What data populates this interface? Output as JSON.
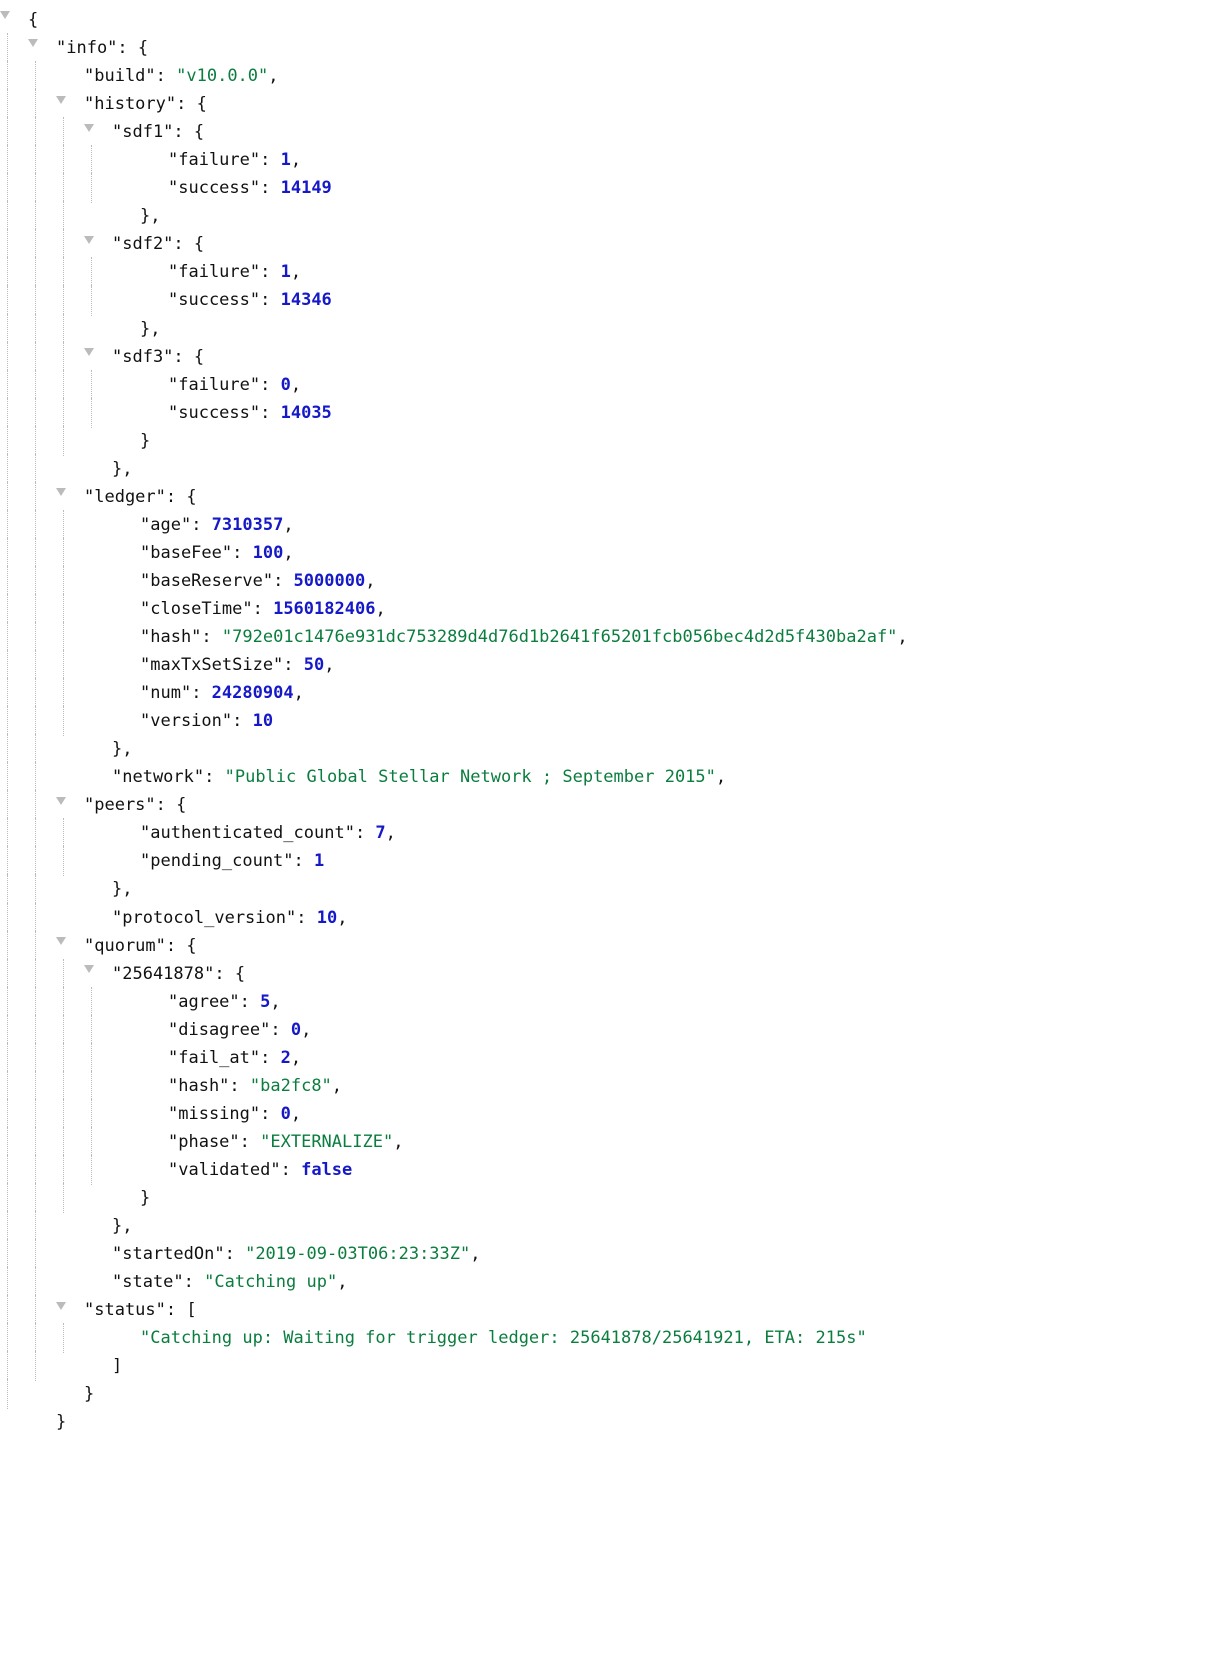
{
  "tree": [
    {
      "depth": 0,
      "guides": "",
      "toggle": true,
      "tokens": [
        {
          "t": "pun",
          "v": "{"
        }
      ]
    },
    {
      "depth": 1,
      "guides": "|",
      "toggle": true,
      "tokens": [
        {
          "t": "key",
          "v": "\"info\""
        },
        {
          "t": "pun",
          "v": ": {"
        }
      ]
    },
    {
      "depth": 2,
      "guides": "||",
      "toggle": false,
      "tokens": [
        {
          "t": "key",
          "v": "\"build\""
        },
        {
          "t": "pun",
          "v": ": "
        },
        {
          "t": "str",
          "v": "\"v10.0.0\""
        },
        {
          "t": "pun",
          "v": ","
        }
      ]
    },
    {
      "depth": 2,
      "guides": "||",
      "toggle": true,
      "tokens": [
        {
          "t": "key",
          "v": "\"history\""
        },
        {
          "t": "pun",
          "v": ": {"
        }
      ]
    },
    {
      "depth": 3,
      "guides": "|||",
      "toggle": true,
      "tokens": [
        {
          "t": "key",
          "v": "\"sdf1\""
        },
        {
          "t": "pun",
          "v": ": {"
        }
      ]
    },
    {
      "depth": 4,
      "guides": "|||| ",
      "toggle": false,
      "tokens": [
        {
          "t": "key",
          "v": "\"failure\""
        },
        {
          "t": "pun",
          "v": ": "
        },
        {
          "t": "num",
          "v": "1"
        },
        {
          "t": "pun",
          "v": ","
        }
      ]
    },
    {
      "depth": 4,
      "guides": "|||| ",
      "toggle": false,
      "tokens": [
        {
          "t": "key",
          "v": "\"success\""
        },
        {
          "t": "pun",
          "v": ": "
        },
        {
          "t": "num",
          "v": "14149"
        }
      ]
    },
    {
      "depth": 3,
      "guides": "||| ",
      "toggle": false,
      "tokens": [
        {
          "t": "pun",
          "v": "},"
        }
      ]
    },
    {
      "depth": 3,
      "guides": "|||",
      "toggle": true,
      "tokens": [
        {
          "t": "key",
          "v": "\"sdf2\""
        },
        {
          "t": "pun",
          "v": ": {"
        }
      ]
    },
    {
      "depth": 4,
      "guides": "|||| ",
      "toggle": false,
      "tokens": [
        {
          "t": "key",
          "v": "\"failure\""
        },
        {
          "t": "pun",
          "v": ": "
        },
        {
          "t": "num",
          "v": "1"
        },
        {
          "t": "pun",
          "v": ","
        }
      ]
    },
    {
      "depth": 4,
      "guides": "|||| ",
      "toggle": false,
      "tokens": [
        {
          "t": "key",
          "v": "\"success\""
        },
        {
          "t": "pun",
          "v": ": "
        },
        {
          "t": "num",
          "v": "14346"
        }
      ]
    },
    {
      "depth": 3,
      "guides": "||| ",
      "toggle": false,
      "tokens": [
        {
          "t": "pun",
          "v": "},"
        }
      ]
    },
    {
      "depth": 3,
      "guides": "|||",
      "toggle": true,
      "tokens": [
        {
          "t": "key",
          "v": "\"sdf3\""
        },
        {
          "t": "pun",
          "v": ": {"
        }
      ]
    },
    {
      "depth": 4,
      "guides": "|||| ",
      "toggle": false,
      "tokens": [
        {
          "t": "key",
          "v": "\"failure\""
        },
        {
          "t": "pun",
          "v": ": "
        },
        {
          "t": "num",
          "v": "0"
        },
        {
          "t": "pun",
          "v": ","
        }
      ]
    },
    {
      "depth": 4,
      "guides": "|||| ",
      "toggle": false,
      "tokens": [
        {
          "t": "key",
          "v": "\"success\""
        },
        {
          "t": "pun",
          "v": ": "
        },
        {
          "t": "num",
          "v": "14035"
        }
      ]
    },
    {
      "depth": 3,
      "guides": "||| ",
      "toggle": false,
      "tokens": [
        {
          "t": "pun",
          "v": "}"
        }
      ]
    },
    {
      "depth": 2,
      "guides": "|| ",
      "toggle": false,
      "tokens": [
        {
          "t": "pun",
          "v": "},"
        }
      ]
    },
    {
      "depth": 2,
      "guides": "||",
      "toggle": true,
      "tokens": [
        {
          "t": "key",
          "v": "\"ledger\""
        },
        {
          "t": "pun",
          "v": ": {"
        }
      ]
    },
    {
      "depth": 3,
      "guides": "||| ",
      "toggle": false,
      "tokens": [
        {
          "t": "key",
          "v": "\"age\""
        },
        {
          "t": "pun",
          "v": ": "
        },
        {
          "t": "num",
          "v": "7310357"
        },
        {
          "t": "pun",
          "v": ","
        }
      ]
    },
    {
      "depth": 3,
      "guides": "||| ",
      "toggle": false,
      "tokens": [
        {
          "t": "key",
          "v": "\"baseFee\""
        },
        {
          "t": "pun",
          "v": ": "
        },
        {
          "t": "num",
          "v": "100"
        },
        {
          "t": "pun",
          "v": ","
        }
      ]
    },
    {
      "depth": 3,
      "guides": "||| ",
      "toggle": false,
      "tokens": [
        {
          "t": "key",
          "v": "\"baseReserve\""
        },
        {
          "t": "pun",
          "v": ": "
        },
        {
          "t": "num",
          "v": "5000000"
        },
        {
          "t": "pun",
          "v": ","
        }
      ]
    },
    {
      "depth": 3,
      "guides": "||| ",
      "toggle": false,
      "tokens": [
        {
          "t": "key",
          "v": "\"closeTime\""
        },
        {
          "t": "pun",
          "v": ": "
        },
        {
          "t": "num",
          "v": "1560182406"
        },
        {
          "t": "pun",
          "v": ","
        }
      ]
    },
    {
      "depth": 3,
      "guides": "||| ",
      "toggle": false,
      "tokens": [
        {
          "t": "key",
          "v": "\"hash\""
        },
        {
          "t": "pun",
          "v": ": "
        },
        {
          "t": "str",
          "v": "\"792e01c1476e931dc753289d4d76d1b2641f65201fcb056bec4d2d5f430ba2af\""
        },
        {
          "t": "pun",
          "v": ","
        }
      ]
    },
    {
      "depth": 3,
      "guides": "||| ",
      "toggle": false,
      "tokens": [
        {
          "t": "key",
          "v": "\"maxTxSetSize\""
        },
        {
          "t": "pun",
          "v": ": "
        },
        {
          "t": "num",
          "v": "50"
        },
        {
          "t": "pun",
          "v": ","
        }
      ]
    },
    {
      "depth": 3,
      "guides": "||| ",
      "toggle": false,
      "tokens": [
        {
          "t": "key",
          "v": "\"num\""
        },
        {
          "t": "pun",
          "v": ": "
        },
        {
          "t": "num",
          "v": "24280904"
        },
        {
          "t": "pun",
          "v": ","
        }
      ]
    },
    {
      "depth": 3,
      "guides": "||| ",
      "toggle": false,
      "tokens": [
        {
          "t": "key",
          "v": "\"version\""
        },
        {
          "t": "pun",
          "v": ": "
        },
        {
          "t": "num",
          "v": "10"
        }
      ]
    },
    {
      "depth": 2,
      "guides": "|| ",
      "toggle": false,
      "tokens": [
        {
          "t": "pun",
          "v": "},"
        }
      ]
    },
    {
      "depth": 2,
      "guides": "|| ",
      "toggle": false,
      "tokens": [
        {
          "t": "key",
          "v": "\"network\""
        },
        {
          "t": "pun",
          "v": ": "
        },
        {
          "t": "str",
          "v": "\"Public Global Stellar Network ; September 2015\""
        },
        {
          "t": "pun",
          "v": ","
        }
      ]
    },
    {
      "depth": 2,
      "guides": "||",
      "toggle": true,
      "tokens": [
        {
          "t": "key",
          "v": "\"peers\""
        },
        {
          "t": "pun",
          "v": ": {"
        }
      ]
    },
    {
      "depth": 3,
      "guides": "||| ",
      "toggle": false,
      "tokens": [
        {
          "t": "key",
          "v": "\"authenticated_count\""
        },
        {
          "t": "pun",
          "v": ": "
        },
        {
          "t": "num",
          "v": "7"
        },
        {
          "t": "pun",
          "v": ","
        }
      ]
    },
    {
      "depth": 3,
      "guides": "||| ",
      "toggle": false,
      "tokens": [
        {
          "t": "key",
          "v": "\"pending_count\""
        },
        {
          "t": "pun",
          "v": ": "
        },
        {
          "t": "num",
          "v": "1"
        }
      ]
    },
    {
      "depth": 2,
      "guides": "|| ",
      "toggle": false,
      "tokens": [
        {
          "t": "pun",
          "v": "},"
        }
      ]
    },
    {
      "depth": 2,
      "guides": "|| ",
      "toggle": false,
      "tokens": [
        {
          "t": "key",
          "v": "\"protocol_version\""
        },
        {
          "t": "pun",
          "v": ": "
        },
        {
          "t": "num",
          "v": "10"
        },
        {
          "t": "pun",
          "v": ","
        }
      ]
    },
    {
      "depth": 2,
      "guides": "||",
      "toggle": true,
      "tokens": [
        {
          "t": "key",
          "v": "\"quorum\""
        },
        {
          "t": "pun",
          "v": ": {"
        }
      ]
    },
    {
      "depth": 3,
      "guides": "|||",
      "toggle": true,
      "tokens": [
        {
          "t": "key",
          "v": "\"25641878\""
        },
        {
          "t": "pun",
          "v": ": {"
        }
      ]
    },
    {
      "depth": 4,
      "guides": "|||| ",
      "toggle": false,
      "tokens": [
        {
          "t": "key",
          "v": "\"agree\""
        },
        {
          "t": "pun",
          "v": ": "
        },
        {
          "t": "num",
          "v": "5"
        },
        {
          "t": "pun",
          "v": ","
        }
      ]
    },
    {
      "depth": 4,
      "guides": "|||| ",
      "toggle": false,
      "tokens": [
        {
          "t": "key",
          "v": "\"disagree\""
        },
        {
          "t": "pun",
          "v": ": "
        },
        {
          "t": "num",
          "v": "0"
        },
        {
          "t": "pun",
          "v": ","
        }
      ]
    },
    {
      "depth": 4,
      "guides": "|||| ",
      "toggle": false,
      "tokens": [
        {
          "t": "key",
          "v": "\"fail_at\""
        },
        {
          "t": "pun",
          "v": ": "
        },
        {
          "t": "num",
          "v": "2"
        },
        {
          "t": "pun",
          "v": ","
        }
      ]
    },
    {
      "depth": 4,
      "guides": "|||| ",
      "toggle": false,
      "tokens": [
        {
          "t": "key",
          "v": "\"hash\""
        },
        {
          "t": "pun",
          "v": ": "
        },
        {
          "t": "str",
          "v": "\"ba2fc8\""
        },
        {
          "t": "pun",
          "v": ","
        }
      ]
    },
    {
      "depth": 4,
      "guides": "|||| ",
      "toggle": false,
      "tokens": [
        {
          "t": "key",
          "v": "\"missing\""
        },
        {
          "t": "pun",
          "v": ": "
        },
        {
          "t": "num",
          "v": "0"
        },
        {
          "t": "pun",
          "v": ","
        }
      ]
    },
    {
      "depth": 4,
      "guides": "|||| ",
      "toggle": false,
      "tokens": [
        {
          "t": "key",
          "v": "\"phase\""
        },
        {
          "t": "pun",
          "v": ": "
        },
        {
          "t": "str",
          "v": "\"EXTERNALIZE\""
        },
        {
          "t": "pun",
          "v": ","
        }
      ]
    },
    {
      "depth": 4,
      "guides": "|||| ",
      "toggle": false,
      "tokens": [
        {
          "t": "key",
          "v": "\"validated\""
        },
        {
          "t": "pun",
          "v": ": "
        },
        {
          "t": "bool",
          "v": "false"
        }
      ]
    },
    {
      "depth": 3,
      "guides": "||| ",
      "toggle": false,
      "tokens": [
        {
          "t": "pun",
          "v": "}"
        }
      ]
    },
    {
      "depth": 2,
      "guides": "|| ",
      "toggle": false,
      "tokens": [
        {
          "t": "pun",
          "v": "},"
        }
      ]
    },
    {
      "depth": 2,
      "guides": "|| ",
      "toggle": false,
      "tokens": [
        {
          "t": "key",
          "v": "\"startedOn\""
        },
        {
          "t": "pun",
          "v": ": "
        },
        {
          "t": "str",
          "v": "\"2019-09-03T06:23:33Z\""
        },
        {
          "t": "pun",
          "v": ","
        }
      ]
    },
    {
      "depth": 2,
      "guides": "|| ",
      "toggle": false,
      "tokens": [
        {
          "t": "key",
          "v": "\"state\""
        },
        {
          "t": "pun",
          "v": ": "
        },
        {
          "t": "str",
          "v": "\"Catching up\""
        },
        {
          "t": "pun",
          "v": ","
        }
      ]
    },
    {
      "depth": 2,
      "guides": "||",
      "toggle": true,
      "tokens": [
        {
          "t": "key",
          "v": "\"status\""
        },
        {
          "t": "pun",
          "v": ": ["
        }
      ]
    },
    {
      "depth": 3,
      "guides": "||| ",
      "toggle": false,
      "tokens": [
        {
          "t": "str",
          "v": "\"Catching up: Waiting for trigger ledger: 25641878/25641921, ETA: 215s\""
        }
      ]
    },
    {
      "depth": 2,
      "guides": "|| ",
      "toggle": false,
      "tokens": [
        {
          "t": "pun",
          "v": "]"
        }
      ]
    },
    {
      "depth": 1,
      "guides": "| ",
      "toggle": false,
      "tokens": [
        {
          "t": "pun",
          "v": "}"
        }
      ]
    },
    {
      "depth": 0,
      "guides": " ",
      "toggle": false,
      "tokens": [
        {
          "t": "pun",
          "v": "}"
        }
      ]
    }
  ]
}
